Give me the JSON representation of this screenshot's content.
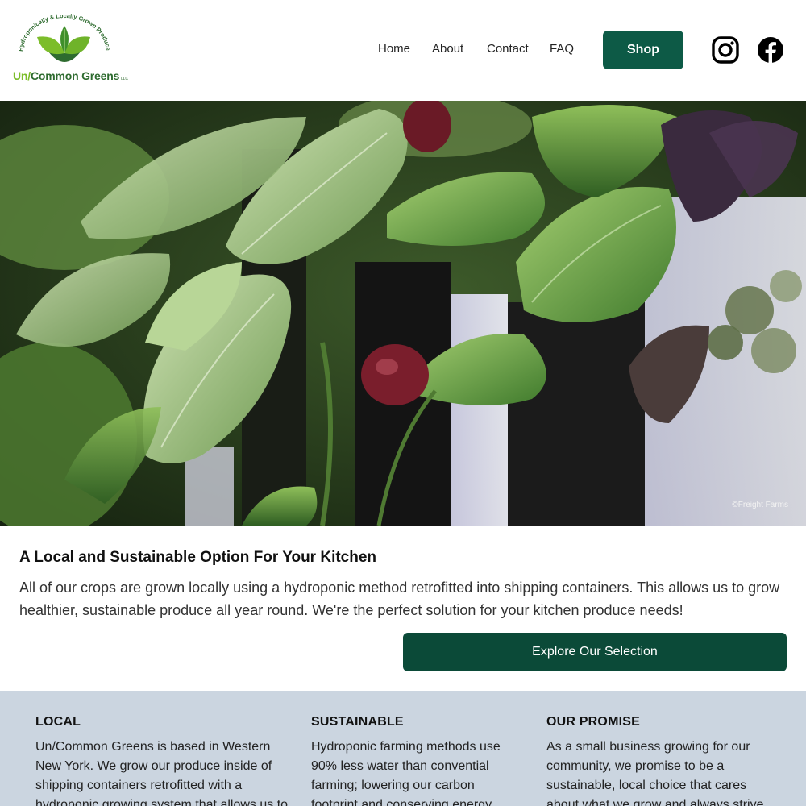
{
  "brand": {
    "arc_text": "Hydroponically & Locally Grown Produce",
    "name_prefix": "Un/",
    "name_main": "Common Greens",
    "name_suffix": "LLC"
  },
  "nav": {
    "home": "Home",
    "about": "About",
    "contact": "Contact",
    "faq": "FAQ",
    "shop": "Shop"
  },
  "social": {
    "instagram_icon": "instagram-icon",
    "facebook_icon": "facebook-icon"
  },
  "hero": {
    "credit": "©Freight Farms"
  },
  "intro": {
    "title": "A Local and Sustainable Option For Your Kitchen",
    "text": "All of our crops are grown locally using a hydroponic method retrofitted into shipping containers. This allows us to grow healthier, sustainable produce all year round. We're the perfect solution for your kitchen produce needs!",
    "button": "Explore Our Selection"
  },
  "features": [
    {
      "title": "LOCAL",
      "text": "Un/Common Greens is based in Western New York. We grow our produce inside of shipping containers retrofitted with a hydroponic growing system that allows us to"
    },
    {
      "title": "SUSTAINABLE",
      "text": "Hydroponic farming methods use 90% less water than convential farming; lowering our carbon footprint and conserving energy"
    },
    {
      "title": "OUR PROMISE",
      "text": "As a small business growing for our community, we promise to be a sustainable, local choice that cares about what we grow and always strive"
    }
  ],
  "colors": {
    "primary": "#0d5a46",
    "features_bg": "#cbd5e0",
    "logo_green": "#2e6b2f",
    "logo_lime": "#7cbd2a"
  }
}
